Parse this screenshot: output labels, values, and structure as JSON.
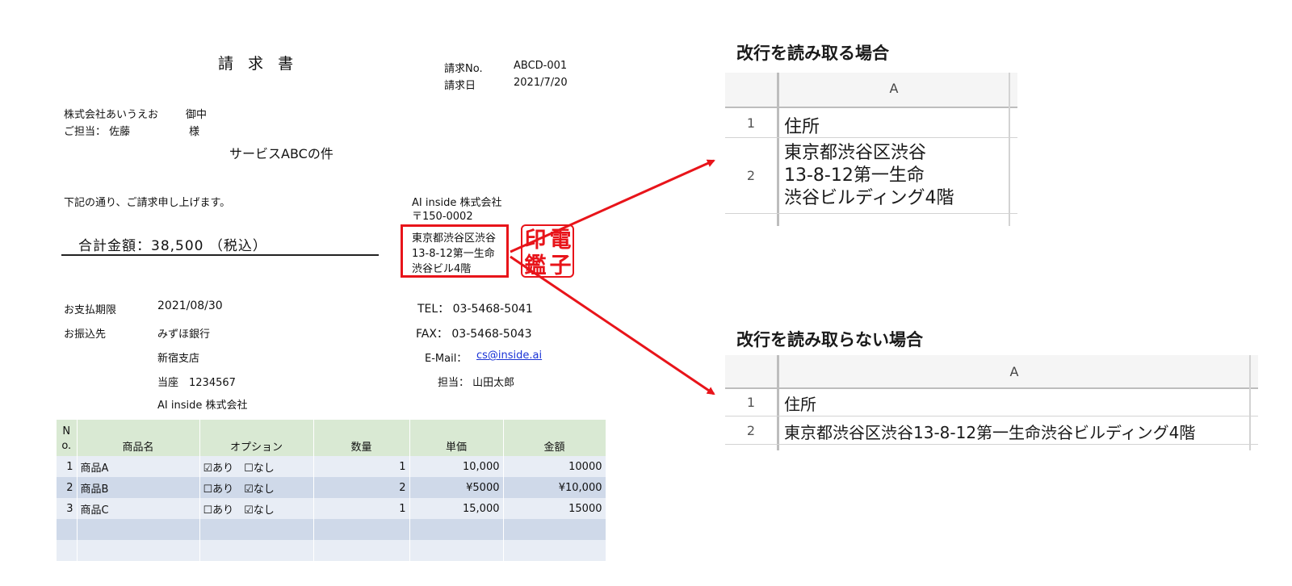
{
  "invoice": {
    "title": "請 求 書",
    "meta": [
      {
        "label": "請求No.",
        "value": "ABCD-001"
      },
      {
        "label": "請求日",
        "value": "2021/7/20"
      }
    ],
    "recipient": {
      "company": "株式会社あいうえお",
      "company_suffix": "御中",
      "contact": "ご担当： 佐藤",
      "contact_suffix": "様"
    },
    "subject": "サービスABCの件",
    "intro": "下記の通り、ご請求申し上げます。",
    "total": "合計金額：38,500 （税込）",
    "payment": {
      "due_label": "お支払期限",
      "due_value": "2021/08/30",
      "bank_label": "お振込先",
      "bank": "みずほ銀行",
      "branch": "新宿支店",
      "account": "当座　1234567",
      "holder": "AI inside 株式会社"
    },
    "issuer": {
      "company": "AI inside 株式会社",
      "postal": "〒150-0002",
      "address_lines": [
        "東京都渋谷区渋谷",
        "13-8-12第一生命",
        "渋谷ビル4階"
      ],
      "tel": "TEL： 03-5468-5041",
      "fax": "FAX： 03-5468-5043",
      "email_label": "E-Mail：",
      "email": "cs@inside.ai",
      "staff": "担当： 山田太郎"
    },
    "stamp": {
      "chars": [
        "印",
        "電",
        "鑑",
        "子"
      ],
      "color": "#e8141a"
    },
    "table": {
      "headers": {
        "no": [
          "N",
          "o."
        ],
        "name": "商品名",
        "option": "オプション",
        "qty": "数量",
        "unit": "単価",
        "amount": "金額"
      },
      "rows": [
        {
          "no": "1",
          "name": "商品A",
          "option": "☑あり　☐なし",
          "qty": "1",
          "unit": "10,000",
          "amount": "10000"
        },
        {
          "no": "2",
          "name": "商品B",
          "option": "☐あり　☑なし",
          "qty": "2",
          "unit": "¥5000",
          "amount": "¥10,000"
        },
        {
          "no": "3",
          "name": "商品C",
          "option": "☐あり　☑なし",
          "qty": "1",
          "unit": "15,000",
          "amount": "15000"
        }
      ]
    }
  },
  "with_breaks": {
    "heading": "改行を読み取る場合",
    "column": "A",
    "rows": [
      {
        "num": "1",
        "lines": [
          "住所"
        ]
      },
      {
        "num": "2",
        "lines": [
          "東京都渋谷区渋谷",
          "13-8-12第一生命",
          "渋谷ビルディング4階"
        ]
      }
    ]
  },
  "without_breaks": {
    "heading": "改行を読み取らない場合",
    "column": "A",
    "rows": [
      {
        "num": "1",
        "text": "住所"
      },
      {
        "num": "2",
        "text": "東京都渋谷区渋谷13-8-12第一生命渋谷ビルディング4階"
      }
    ]
  },
  "colors": {
    "highlight": "#e8141a",
    "link": "#1a33d6",
    "table_header": "#d9e9d3"
  }
}
